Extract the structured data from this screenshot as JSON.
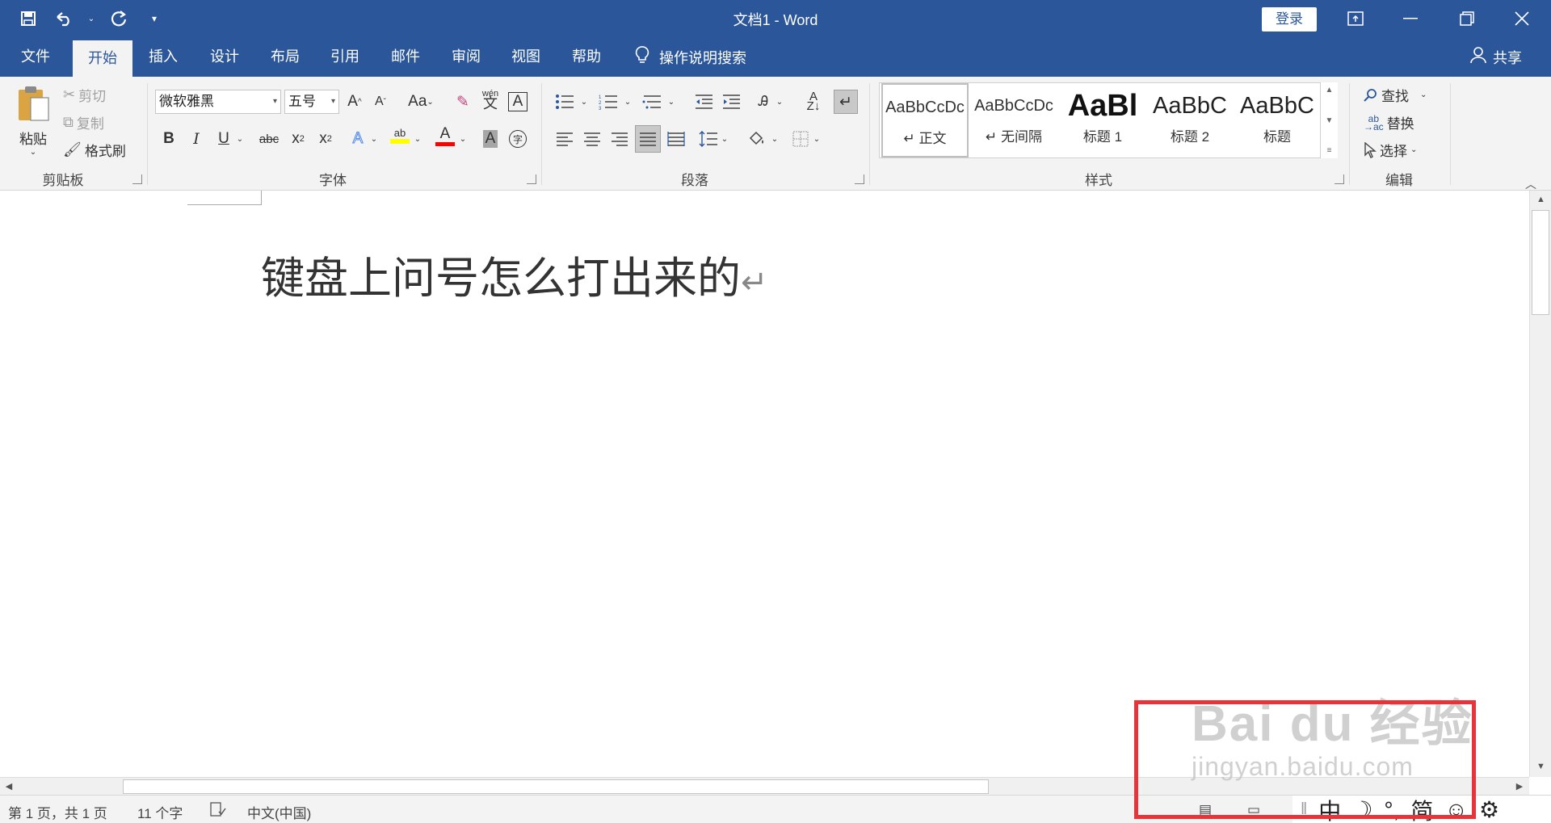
{
  "window": {
    "title": "文档1  -  Word",
    "login_label": "登录"
  },
  "qat": {
    "icons": [
      "save-icon",
      "undo-icon",
      "redo-icon",
      "customize-icon"
    ]
  },
  "tabs": {
    "file": "文件",
    "home": "开始",
    "insert": "插入",
    "design": "设计",
    "layout": "布局",
    "references": "引用",
    "mailings": "邮件",
    "review": "审阅",
    "view": "视图",
    "help": "帮助",
    "tell_me": "操作说明搜索",
    "share": "共享"
  },
  "clipboard": {
    "paste": "粘贴",
    "cut": "剪切",
    "copy": "复制",
    "format_painter": "格式刷",
    "label": "剪贴板"
  },
  "font": {
    "name": "微软雅黑",
    "size": "五号",
    "label": "字体",
    "bold": "B",
    "italic": "I",
    "underline": "U",
    "strike": "abc",
    "grow": "A",
    "shrink": "A",
    "case": "Aa",
    "phonetic_top": "wén",
    "phonetic_main": "文",
    "border_char": "A",
    "effects": "A",
    "highlight": "ab",
    "color_char": "A",
    "shading_char": "A",
    "enclose_char": "字",
    "highlight_color": "#ffff00",
    "font_color": "#ff0000"
  },
  "paragraph": {
    "label": "段落"
  },
  "styles": {
    "label": "样式",
    "items": [
      {
        "preview": "AaBbCcDc",
        "name": "↵ 正文"
      },
      {
        "preview": "AaBbCcDc",
        "name": "↵ 无间隔"
      },
      {
        "preview": "AaBl",
        "name": "标题 1"
      },
      {
        "preview": "AaBbC",
        "name": "标题 2"
      },
      {
        "preview": "AaBbC",
        "name": "标题"
      }
    ]
  },
  "editing": {
    "find": "查找",
    "replace": "替换",
    "select": "选择",
    "label": "编辑",
    "replace_icon_text": "ab"
  },
  "document": {
    "text": "键盘上问号怎么打出来的",
    "para_mark": "↵"
  },
  "statusbar": {
    "page": "第 1 页，共 1 页",
    "words": "11 个字",
    "language": "中文(中国)"
  },
  "ime": {
    "mode": "中",
    "moon": "☽",
    "punct": "°,",
    "simplified": "简",
    "emoji": "☺",
    "settings": "⚙"
  },
  "watermark": {
    "main": "Bai du 经验",
    "sub": "jingyan.baidu.com"
  },
  "colors": {
    "brand": "#2b579a",
    "highlight_box": "#e8333b"
  }
}
